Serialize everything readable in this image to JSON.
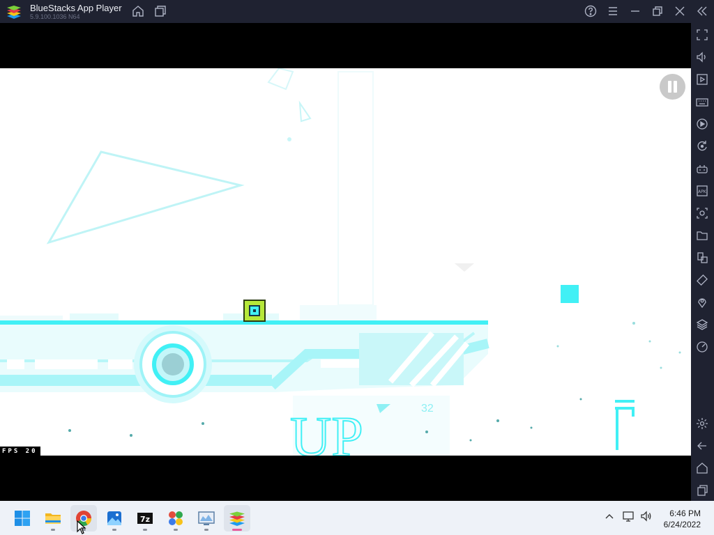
{
  "window": {
    "title": "BlueStacks App Player",
    "version": "5.9.100.1036 N64",
    "titlebar_icons": [
      "home-icon",
      "multi-instance-icon",
      "help-icon",
      "menu-icon",
      "minimize-icon",
      "restore-icon",
      "close-icon",
      "collapse-sidebar-icon"
    ]
  },
  "sidebar": {
    "items": [
      "fullscreen-icon",
      "volume-icon",
      "media-manager-icon",
      "keyboard-controls-icon",
      "macro-record-icon",
      "sync-icon",
      "game-controls-icon",
      "install-apk-icon",
      "screenshot-icon",
      "folder-icon",
      "multi-instance-manager-icon",
      "rotate-icon",
      "location-icon",
      "layers-icon",
      "eco-mode-icon",
      "settings-icon",
      "back-icon",
      "home-icon",
      "recent-apps-icon"
    ]
  },
  "game": {
    "fps_label": "FPS  20",
    "sign_text": "UP",
    "level_number": "32"
  },
  "taskbar": {
    "apps": [
      "start-icon",
      "file-explorer-icon",
      "chrome-icon",
      "photos-icon",
      "7zip-icon",
      "game-app-icon",
      "monitor-app-icon",
      "bluestacks-icon"
    ],
    "time": "6:46 PM",
    "date": "6/24/2022"
  },
  "colors": {
    "titlebar": "#1f2231",
    "game_cyan": "#41f0f5",
    "player_green": "#b6e83a",
    "taskbar": "#eef2f8"
  }
}
